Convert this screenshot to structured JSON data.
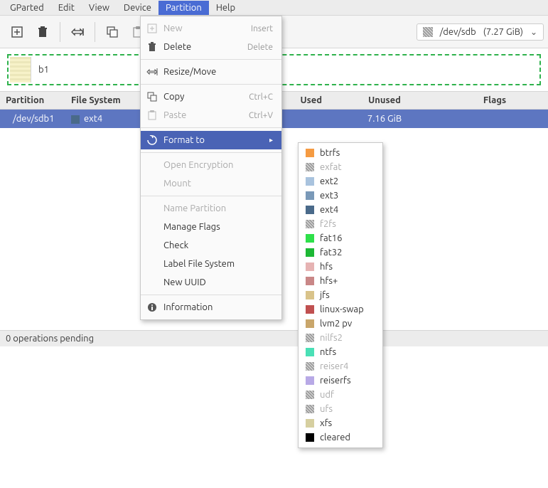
{
  "menubar": [
    "GParted",
    "Edit",
    "View",
    "Device",
    "Partition",
    "Help"
  ],
  "menubar_active_index": 4,
  "device_picker": {
    "name": "/dev/sdb",
    "size": "(7.27 GiB)"
  },
  "viz": {
    "label": "b1"
  },
  "columns": [
    "Partition",
    "File System",
    "",
    "Used",
    "Unused",
    "Flags"
  ],
  "row": {
    "partition": "/dev/sdb1",
    "fs": "ext4",
    "unused": "7.16 GiB"
  },
  "status": "0 operations pending",
  "menu": [
    {
      "label": "New",
      "accel": "Insert",
      "disabled": true,
      "icon": "plus"
    },
    {
      "label": "Delete",
      "accel": "Delete",
      "icon": "trash"
    },
    {
      "sep": true
    },
    {
      "label": "Resize/Move",
      "icon": "resize"
    },
    {
      "sep": true
    },
    {
      "label": "Copy",
      "accel": "Ctrl+C",
      "icon": "copy"
    },
    {
      "label": "Paste",
      "accel": "Ctrl+V",
      "disabled": true,
      "icon": "paste"
    },
    {
      "sep": true
    },
    {
      "label": "Format to",
      "highlight": true,
      "submenu": true,
      "icon": "convert"
    },
    {
      "sep": true
    },
    {
      "label": "Open Encryption",
      "disabled": true
    },
    {
      "label": "Mount",
      "disabled": true
    },
    {
      "sep": true
    },
    {
      "label": "Name Partition",
      "disabled": true
    },
    {
      "label": "Manage Flags"
    },
    {
      "label": "Check"
    },
    {
      "label": "Label File System"
    },
    {
      "label": "New UUID"
    },
    {
      "sep": true
    },
    {
      "label": "Information",
      "icon": "info"
    }
  ],
  "fs_list": [
    {
      "name": "btrfs",
      "color": "#f59b42"
    },
    {
      "name": "exfat",
      "hatch": true,
      "disabled": true
    },
    {
      "name": "ext2",
      "color": "#a9c3de"
    },
    {
      "name": "ext3",
      "color": "#7a99b8"
    },
    {
      "name": "ext4",
      "color": "#4a6a8a"
    },
    {
      "name": "f2fs",
      "hatch": true,
      "disabled": true
    },
    {
      "name": "fat16",
      "color": "#2ee04a"
    },
    {
      "name": "fat32",
      "color": "#1db835"
    },
    {
      "name": "hfs",
      "color": "#e6b3b3"
    },
    {
      "name": "hfs+",
      "color": "#c98787"
    },
    {
      "name": "jfs",
      "color": "#d9c38a"
    },
    {
      "name": "linux-swap",
      "color": "#c05050"
    },
    {
      "name": "lvm2 pv",
      "color": "#c9a66b"
    },
    {
      "name": "nilfs2",
      "hatch": true,
      "disabled": true
    },
    {
      "name": "ntfs",
      "color": "#4ae0b6"
    },
    {
      "name": "reiser4",
      "hatch": true,
      "disabled": true
    },
    {
      "name": "reiserfs",
      "color": "#b8a9e6"
    },
    {
      "name": "udf",
      "hatch": true,
      "disabled": true
    },
    {
      "name": "ufs",
      "hatch": true,
      "disabled": true
    },
    {
      "name": "xfs",
      "color": "#d6cfa0"
    },
    {
      "name": "cleared",
      "color": "#000000"
    }
  ]
}
